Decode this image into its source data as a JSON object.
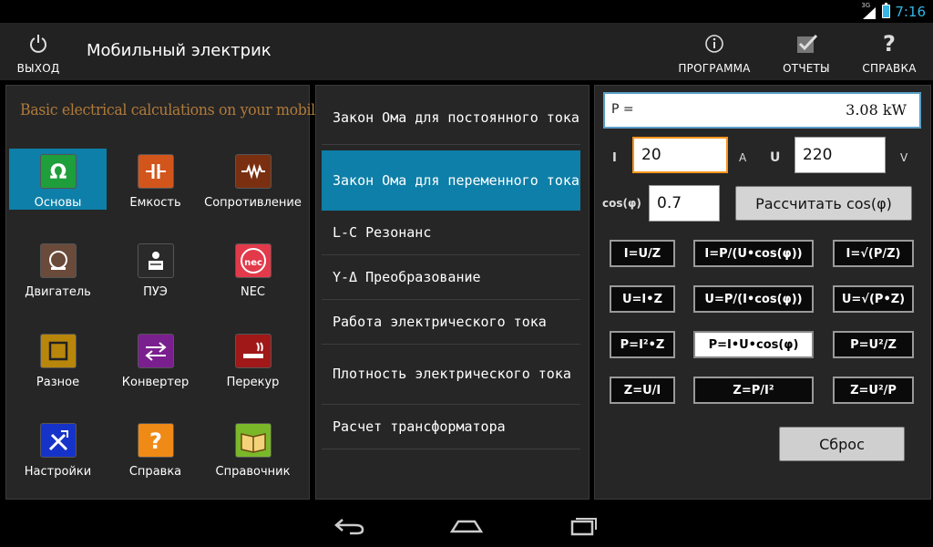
{
  "status": {
    "time": "7:16",
    "network": "3G"
  },
  "actionbar": {
    "exit_label": "ВЫХОД",
    "title": "Мобильный электрик",
    "program_label": "ПРОГРАММА",
    "reports_label": "ОТЧЕТЫ",
    "help_label": "СПРАВКА"
  },
  "left": {
    "tagline": "Basic electrical calculations on your mobile phone",
    "items": [
      {
        "label": "Основы",
        "icon": "omega-icon",
        "color": "#1f9e3c"
      },
      {
        "label": "Емкость",
        "icon": "capacitor-icon",
        "color": "#d2551c"
      },
      {
        "label": "Сопротивление",
        "icon": "resistor-icon",
        "color": "#7a3010"
      },
      {
        "label": "Двигатель",
        "icon": "motor-icon",
        "color": "#6a4a3a"
      },
      {
        "label": "ПУЭ",
        "icon": "reader-icon",
        "color": "#2a2a2a"
      },
      {
        "label": "NEC",
        "icon": "nec-icon",
        "color": "#e23a4a"
      },
      {
        "label": "Разное",
        "icon": "square-icon",
        "color": "#b8860b"
      },
      {
        "label": "Конвертер",
        "icon": "arrows-icon",
        "color": "#7a1f8e"
      },
      {
        "label": "Перекур",
        "icon": "cigarette-icon",
        "color": "#a01818"
      },
      {
        "label": "Настройки",
        "icon": "tools-icon",
        "color": "#1633c9"
      },
      {
        "label": "Справка",
        "icon": "question-icon",
        "color": "#f08a16"
      },
      {
        "label": "Справочник",
        "icon": "book-icon",
        "color": "#7ab82a"
      }
    ]
  },
  "list": {
    "items": [
      "Закон Ома для постоянного тока",
      "Закон Ома для переменного тока",
      "L-C Резонанс",
      "Y-Δ Преобразование",
      "Работа электрического тока",
      "Плотность электрического тока",
      "Расчет трансформатора"
    ]
  },
  "calc": {
    "result_key": "P =",
    "result_value": "3.08 kW",
    "i_label": "I",
    "i_value": "20",
    "i_unit": "A",
    "u_label": "U",
    "u_value": "220",
    "u_unit": "V",
    "cos_label": "cos(φ)",
    "cos_value": "0.7",
    "calc_cos_label": "Рассчитать cos(φ)",
    "formulas": [
      "I=U/Z",
      "I=P/(U•cos(φ))",
      "I=√(P/Z)",
      "U=I•Z",
      "U=P/(I•cos(φ))",
      "U=√(P•Z)",
      "P=I²•Z",
      "P=I•U•cos(φ)",
      "P=U²/Z",
      "Z=U/I",
      "Z=P/I²",
      "Z=U²/P"
    ],
    "reset_label": "Сброс"
  }
}
